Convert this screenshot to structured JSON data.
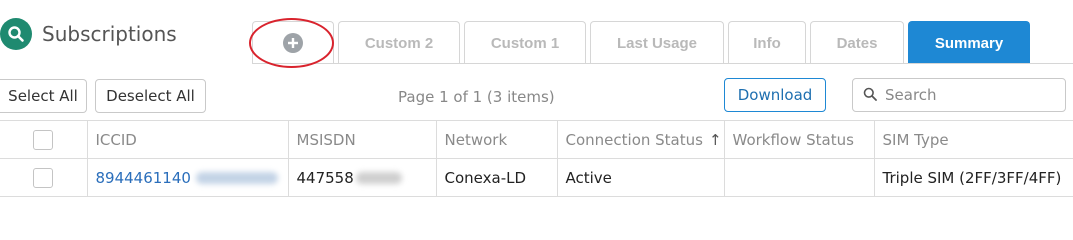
{
  "header": {
    "title": "Subscriptions"
  },
  "tabs": [
    {
      "label": "Custom 2"
    },
    {
      "label": "Custom 1"
    },
    {
      "label": "Last Usage"
    },
    {
      "label": "Info"
    },
    {
      "label": "Dates"
    },
    {
      "label": "Summary",
      "active": true
    }
  ],
  "toolbar": {
    "select_all": "Select All",
    "deselect_all": "Deselect All",
    "page_info": "Page 1 of 1 (3 items)",
    "download": "Download",
    "search_placeholder": "Search"
  },
  "table": {
    "columns": [
      "ICCID",
      "MSISDN",
      "Network",
      "Connection Status",
      "Workflow Status",
      "SIM Type"
    ],
    "sort_indicator": "↑",
    "rows": [
      {
        "iccid": "8944461140",
        "msisdn": "447558",
        "network": "Conexa-LD",
        "connection_status": "Active",
        "workflow_status": "",
        "sim_type": "Triple SIM (2FF/3FF/4FF)"
      }
    ]
  },
  "colors": {
    "accent": "#1e88d4",
    "brand": "#1f8a70",
    "highlight": "#d9232d"
  }
}
